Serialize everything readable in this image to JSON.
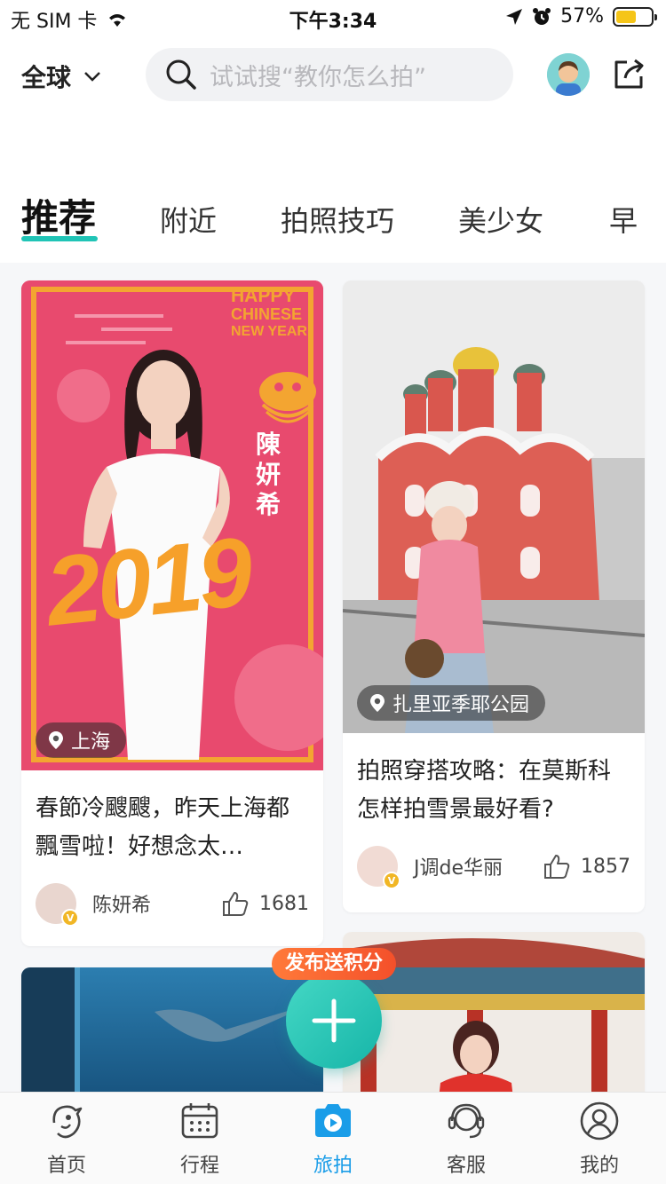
{
  "status_bar": {
    "carrier": "无 SIM 卡",
    "time": "下午3:34",
    "battery": "57%",
    "battery_level": 0.57
  },
  "header": {
    "region_label": "全球",
    "search_placeholder": "试试搜“教你怎么拍”"
  },
  "tabs": [
    "推荐",
    "附近",
    "拍照技巧",
    "美少女",
    "早"
  ],
  "cards": [
    {
      "location": "上海",
      "image_text": {
        "line1": "HAPPY",
        "line2": "CHINESE",
        "line3": "NEW YEAR",
        "name_vertical": "陳妍希",
        "year": "2019"
      },
      "title": "春節冷颼颼，昨天上海都飄雪啦！好想念太…",
      "author": "陈妍希",
      "likes": "1681"
    },
    {
      "location": "扎里亚季耶公园",
      "title": "拍照穿搭攻略：在莫斯科怎样拍雪景最好看?",
      "author": "J调de华丽",
      "likes": "1857"
    }
  ],
  "verified_badge": "V",
  "fab": {
    "label": "发布送积分"
  },
  "bottom_nav": [
    {
      "label": "首页",
      "icon": "home-icon"
    },
    {
      "label": "行程",
      "icon": "calendar-icon"
    },
    {
      "label": "旅拍",
      "icon": "camera-icon"
    },
    {
      "label": "客服",
      "icon": "headset-icon"
    },
    {
      "label": "我的",
      "icon": "user-icon"
    }
  ],
  "colors": {
    "accent": "#20c4b6",
    "nav_active": "#1a9de8",
    "fab_label": "#f4502a",
    "card1_bg": "#e84a6e"
  }
}
